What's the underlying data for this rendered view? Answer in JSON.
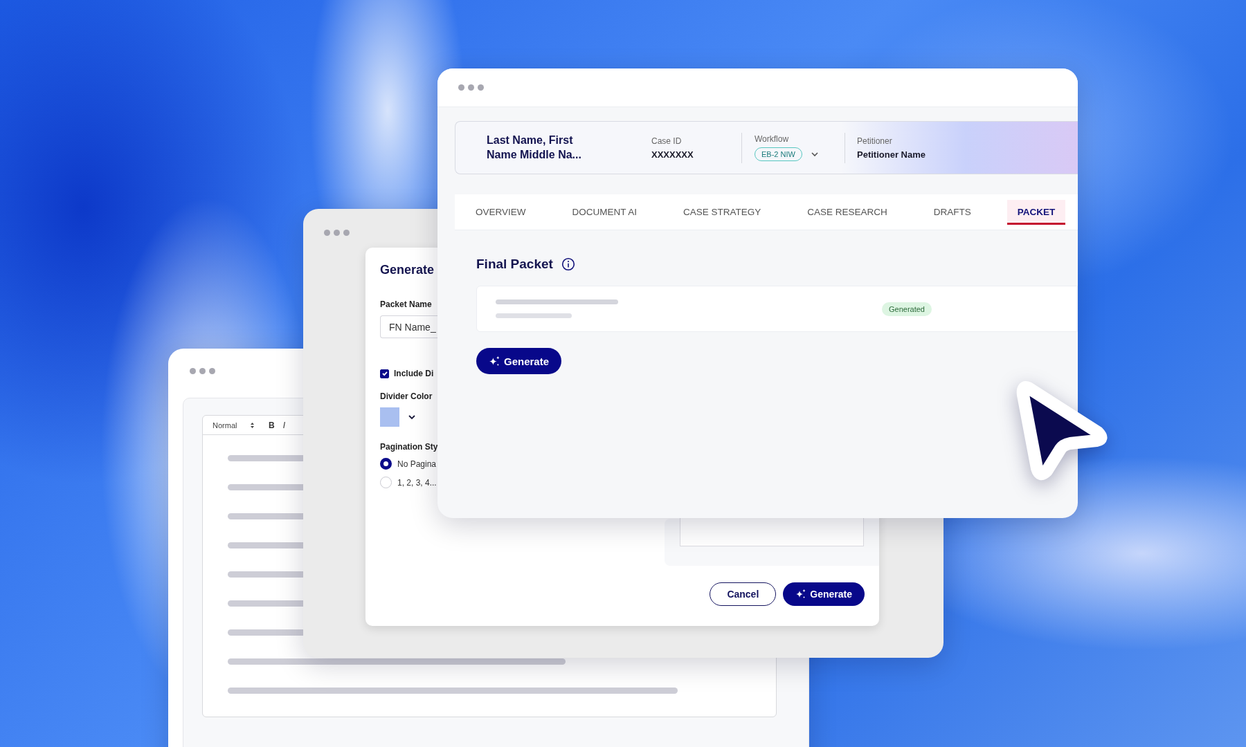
{
  "editor_window": {
    "toolbar": {
      "style": "Normal",
      "bold": "B",
      "italic": "I"
    }
  },
  "dialog_window": {
    "title": "Generate",
    "packet_name": {
      "label": "Packet Name",
      "value": "FN Name_"
    },
    "include_dividers": {
      "label": "Include Di",
      "checked": true
    },
    "divider_color": {
      "label": "Divider Color"
    },
    "pagination": {
      "label": "Pagination Sty",
      "options": [
        {
          "label": "No Pagina",
          "selected": true
        },
        {
          "label": "1, 2, 3, 4...",
          "selected": false
        }
      ]
    },
    "buttons": [
      {
        "label": "Cancel",
        "kind": "secondary"
      },
      {
        "label": "Generate",
        "kind": "primary"
      }
    ]
  },
  "main_window": {
    "case": {
      "name": "Last Name, First Name Middle Na...",
      "fields": [
        {
          "label": "Case ID",
          "value": "XXXXXXX",
          "kind": "text"
        },
        {
          "label": "Workflow",
          "value": "EB-2 NIW",
          "kind": "dropdown"
        },
        {
          "label": "Petitioner",
          "value": "Petitioner Name",
          "kind": "text"
        }
      ]
    },
    "tabs": [
      {
        "label": "OVERVIEW",
        "selected": false
      },
      {
        "label": "DOCUMENT AI",
        "selected": false
      },
      {
        "label": "CASE STRATEGY",
        "selected": false
      },
      {
        "label": "CASE RESEARCH",
        "selected": false
      },
      {
        "label": "DRAFTS",
        "selected": false
      },
      {
        "label": "PACKET",
        "selected": true
      }
    ],
    "section_title": "Final Packet",
    "packet_row": {
      "status": "Generated"
    },
    "generate_button": "Generate"
  }
}
